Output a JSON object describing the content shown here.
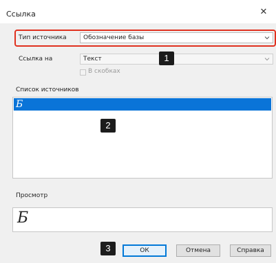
{
  "window": {
    "title": "Ссылка",
    "close_icon": "close-icon"
  },
  "form": {
    "source_type_label": "Тип источника",
    "source_type_value": "Обозначение базы",
    "link_to_label": "Ссылка на",
    "link_to_value": "Текст",
    "in_brackets_label": "В скобках",
    "in_brackets_checked": false,
    "sources_label": "Список источников",
    "sources_items": [
      "Б"
    ],
    "preview_label": "Просмотр",
    "preview_value": "Б"
  },
  "annotations": {
    "badge1": "1",
    "badge2": "2",
    "badge3": "3",
    "highlight_color": "#e0301e"
  },
  "buttons": {
    "ok": "ОК",
    "cancel": "Отмена",
    "help": "Справка"
  },
  "colors": {
    "selection": "#0a74d8",
    "dialog_bg": "#f0f0f0"
  }
}
